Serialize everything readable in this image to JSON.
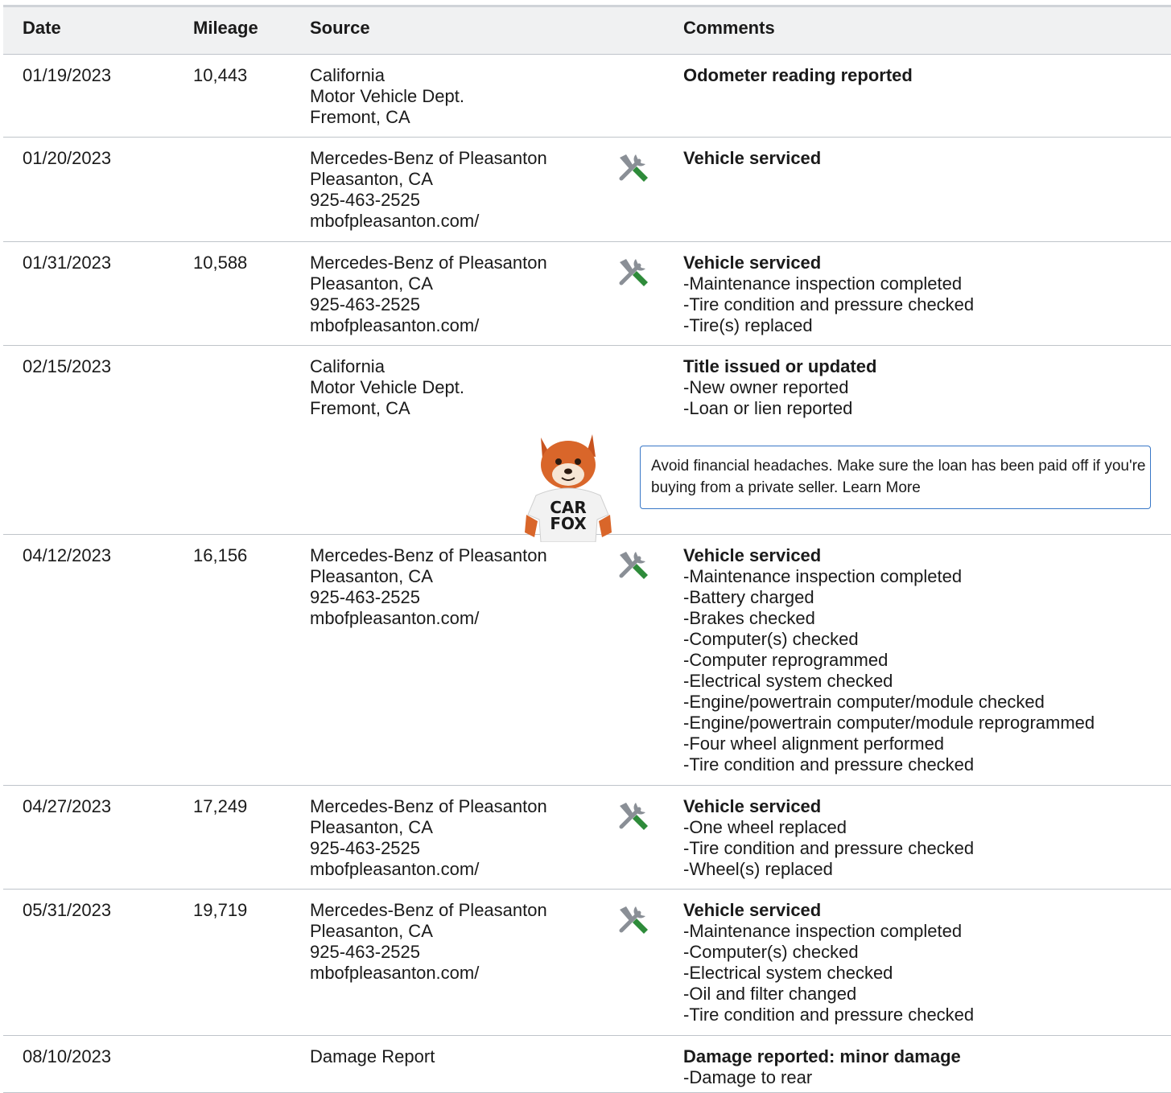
{
  "headers": {
    "date": "Date",
    "mileage": "Mileage",
    "source": "Source",
    "comments": "Comments"
  },
  "rows": [
    {
      "date": "01/19/2023",
      "mileage": "10,443",
      "source": [
        "California",
        "Motor Vehicle Dept.",
        "Fremont, CA"
      ],
      "icon": "",
      "comment_title": "Odometer reading reported",
      "items": []
    },
    {
      "date": "01/20/2023",
      "mileage": "",
      "source": [
        "Mercedes-Benz of Pleasanton",
        "Pleasanton, CA",
        "925-463-2525",
        "mbofpleasanton.com/"
      ],
      "icon": "service-wrench-icon",
      "comment_title": "Vehicle serviced",
      "items": []
    },
    {
      "date": "01/31/2023",
      "mileage": "10,588",
      "source": [
        "Mercedes-Benz of Pleasanton",
        "Pleasanton, CA",
        "925-463-2525",
        "mbofpleasanton.com/"
      ],
      "icon": "service-wrench-icon",
      "comment_title": "Vehicle serviced",
      "items": [
        "Maintenance inspection completed",
        "Tire condition and pressure checked",
        "Tire(s) replaced"
      ]
    },
    {
      "date": "02/15/2023",
      "mileage": "",
      "source": [
        "California",
        "Motor Vehicle Dept.",
        "Fremont, CA"
      ],
      "icon": "",
      "comment_title": "Title issued or updated",
      "items": [
        "New owner reported",
        "Loan or lien reported"
      ],
      "tip": {
        "text": "Avoid financial headaches. Make sure the loan has been paid off if you're buying from a private seller.",
        "link": "Learn More",
        "mascot_text": [
          "CAR",
          "FOX"
        ]
      }
    },
    {
      "date": "04/12/2023",
      "mileage": "16,156",
      "source": [
        "Mercedes-Benz of Pleasanton",
        "Pleasanton, CA",
        "925-463-2525",
        "mbofpleasanton.com/"
      ],
      "icon": "service-wrench-icon",
      "comment_title": "Vehicle serviced",
      "items": [
        "Maintenance inspection completed",
        "Battery charged",
        "Brakes checked",
        "Computer(s) checked",
        "Computer reprogrammed",
        "Electrical system checked",
        "Engine/powertrain computer/module checked",
        "Engine/powertrain computer/module reprogrammed",
        "Four wheel alignment performed",
        "Tire condition and pressure checked"
      ]
    },
    {
      "date": "04/27/2023",
      "mileage": "17,249",
      "source": [
        "Mercedes-Benz of Pleasanton",
        "Pleasanton, CA",
        "925-463-2525",
        "mbofpleasanton.com/"
      ],
      "icon": "service-wrench-icon",
      "comment_title": "Vehicle serviced",
      "items": [
        "One wheel replaced",
        "Tire condition and pressure checked",
        "Wheel(s) replaced"
      ]
    },
    {
      "date": "05/31/2023",
      "mileage": "19,719",
      "source": [
        "Mercedes-Benz of Pleasanton",
        "Pleasanton, CA",
        "925-463-2525",
        "mbofpleasanton.com/"
      ],
      "icon": "service-wrench-icon",
      "comment_title": "Vehicle serviced",
      "items": [
        "Maintenance inspection completed",
        "Computer(s) checked",
        "Electrical system checked",
        "Oil and filter changed",
        "Tire condition and pressure checked"
      ]
    },
    {
      "date": "08/10/2023",
      "mileage": "",
      "source": [
        "Damage Report"
      ],
      "icon": "",
      "comment_title": "Damage reported: minor damage",
      "items": [
        "Damage to rear"
      ]
    }
  ],
  "colors": {
    "header_bg": "#f0f1f2",
    "row_border": "#bfc4ca",
    "tip_border": "#3877c7",
    "wrench_gray": "#8a8f96",
    "screwdriver_green": "#2e8b3a"
  }
}
